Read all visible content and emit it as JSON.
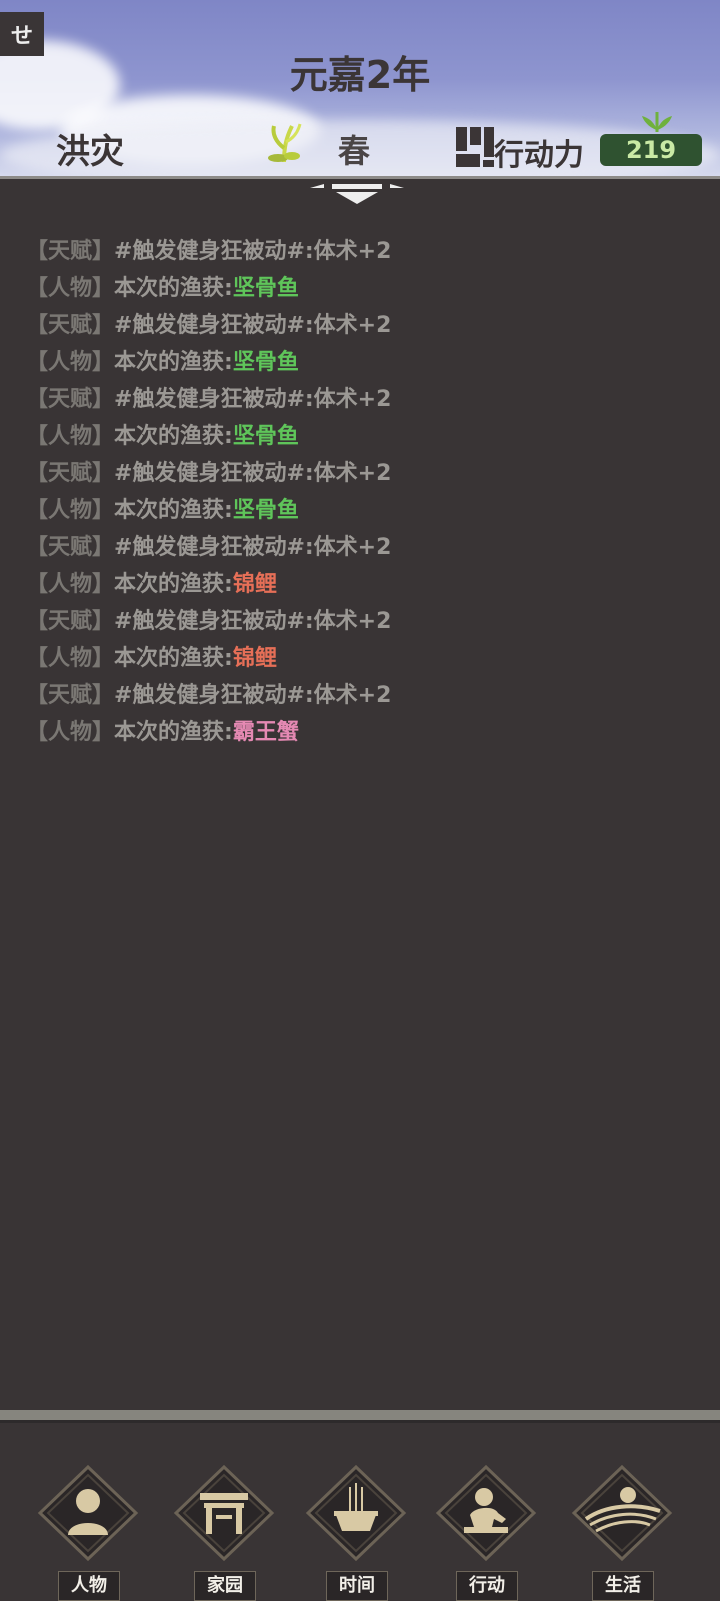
{
  "header": {
    "corner_tab": "せ",
    "year": "元嘉2年",
    "disaster": "洪灾",
    "season": "春",
    "action_label": "行动力",
    "action_value": "219"
  },
  "log": [
    {
      "tag": "【天赋】",
      "text": "#触发健身狂被动#:体术+2",
      "highlight": "",
      "color": ""
    },
    {
      "tag": "【人物】",
      "text": "本次的渔获:",
      "highlight": "坚骨鱼",
      "color": "green"
    },
    {
      "tag": "【天赋】",
      "text": "#触发健身狂被动#:体术+2",
      "highlight": "",
      "color": ""
    },
    {
      "tag": "【人物】",
      "text": "本次的渔获:",
      "highlight": "坚骨鱼",
      "color": "green"
    },
    {
      "tag": "【天赋】",
      "text": "#触发健身狂被动#:体术+2",
      "highlight": "",
      "color": ""
    },
    {
      "tag": "【人物】",
      "text": "本次的渔获:",
      "highlight": "坚骨鱼",
      "color": "green"
    },
    {
      "tag": "【天赋】",
      "text": "#触发健身狂被动#:体术+2",
      "highlight": "",
      "color": ""
    },
    {
      "tag": "【人物】",
      "text": "本次的渔获:",
      "highlight": "坚骨鱼",
      "color": "green"
    },
    {
      "tag": "【天赋】",
      "text": "#触发健身狂被动#:体术+2",
      "highlight": "",
      "color": ""
    },
    {
      "tag": "【人物】",
      "text": "本次的渔获:",
      "highlight": "锦鲤",
      "color": "red"
    },
    {
      "tag": "【天赋】",
      "text": "#触发健身狂被动#:体术+2",
      "highlight": "",
      "color": ""
    },
    {
      "tag": "【人物】",
      "text": "本次的渔获:",
      "highlight": "锦鲤",
      "color": "red"
    },
    {
      "tag": "【天赋】",
      "text": "#触发健身狂被动#:体术+2",
      "highlight": "",
      "color": ""
    },
    {
      "tag": "【人物】",
      "text": "本次的渔获:",
      "highlight": "霸王蟹",
      "color": "pink"
    }
  ],
  "nav": [
    {
      "label": "人物",
      "icon": "person-icon"
    },
    {
      "label": "家园",
      "icon": "gate-icon"
    },
    {
      "label": "时间",
      "icon": "incense-icon"
    },
    {
      "label": "行动",
      "icon": "worker-icon"
    },
    {
      "label": "生活",
      "icon": "sunrise-fields-icon"
    }
  ],
  "colors": {
    "background": "#393435",
    "badge_bg": "#2f5230",
    "highlight_green": "#5fc55a",
    "highlight_red": "#e66f57",
    "highlight_pink": "#e589b3"
  }
}
